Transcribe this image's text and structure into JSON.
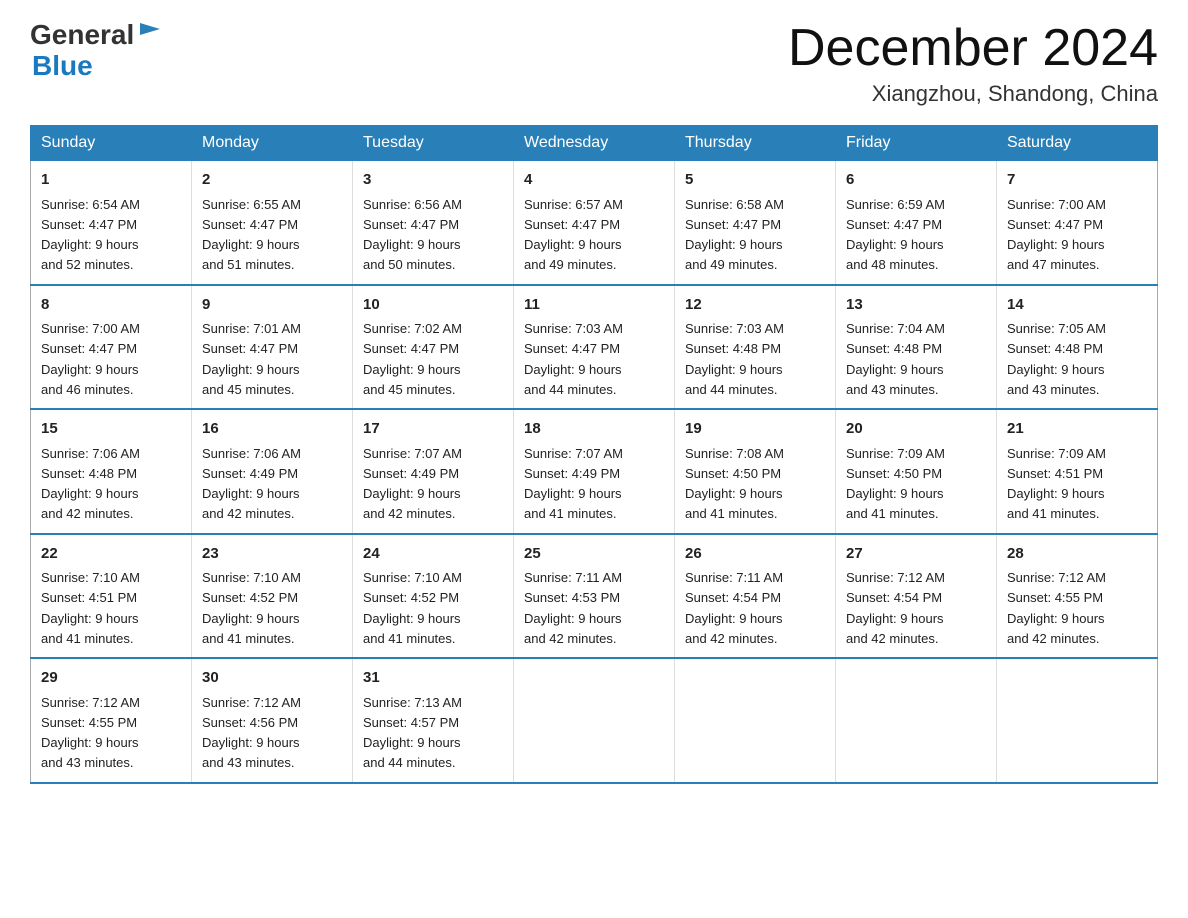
{
  "header": {
    "logo_general": "General",
    "logo_blue": "Blue",
    "month_year": "December 2024",
    "location": "Xiangzhou, Shandong, China"
  },
  "days_of_week": [
    "Sunday",
    "Monday",
    "Tuesday",
    "Wednesday",
    "Thursday",
    "Friday",
    "Saturday"
  ],
  "weeks": [
    [
      {
        "day": "1",
        "sunrise": "6:54 AM",
        "sunset": "4:47 PM",
        "daylight": "9 hours and 52 minutes."
      },
      {
        "day": "2",
        "sunrise": "6:55 AM",
        "sunset": "4:47 PM",
        "daylight": "9 hours and 51 minutes."
      },
      {
        "day": "3",
        "sunrise": "6:56 AM",
        "sunset": "4:47 PM",
        "daylight": "9 hours and 50 minutes."
      },
      {
        "day": "4",
        "sunrise": "6:57 AM",
        "sunset": "4:47 PM",
        "daylight": "9 hours and 49 minutes."
      },
      {
        "day": "5",
        "sunrise": "6:58 AM",
        "sunset": "4:47 PM",
        "daylight": "9 hours and 49 minutes."
      },
      {
        "day": "6",
        "sunrise": "6:59 AM",
        "sunset": "4:47 PM",
        "daylight": "9 hours and 48 minutes."
      },
      {
        "day": "7",
        "sunrise": "7:00 AM",
        "sunset": "4:47 PM",
        "daylight": "9 hours and 47 minutes."
      }
    ],
    [
      {
        "day": "8",
        "sunrise": "7:00 AM",
        "sunset": "4:47 PM",
        "daylight": "9 hours and 46 minutes."
      },
      {
        "day": "9",
        "sunrise": "7:01 AM",
        "sunset": "4:47 PM",
        "daylight": "9 hours and 45 minutes."
      },
      {
        "day": "10",
        "sunrise": "7:02 AM",
        "sunset": "4:47 PM",
        "daylight": "9 hours and 45 minutes."
      },
      {
        "day": "11",
        "sunrise": "7:03 AM",
        "sunset": "4:47 PM",
        "daylight": "9 hours and 44 minutes."
      },
      {
        "day": "12",
        "sunrise": "7:03 AM",
        "sunset": "4:48 PM",
        "daylight": "9 hours and 44 minutes."
      },
      {
        "day": "13",
        "sunrise": "7:04 AM",
        "sunset": "4:48 PM",
        "daylight": "9 hours and 43 minutes."
      },
      {
        "day": "14",
        "sunrise": "7:05 AM",
        "sunset": "4:48 PM",
        "daylight": "9 hours and 43 minutes."
      }
    ],
    [
      {
        "day": "15",
        "sunrise": "7:06 AM",
        "sunset": "4:48 PM",
        "daylight": "9 hours and 42 minutes."
      },
      {
        "day": "16",
        "sunrise": "7:06 AM",
        "sunset": "4:49 PM",
        "daylight": "9 hours and 42 minutes."
      },
      {
        "day": "17",
        "sunrise": "7:07 AM",
        "sunset": "4:49 PM",
        "daylight": "9 hours and 42 minutes."
      },
      {
        "day": "18",
        "sunrise": "7:07 AM",
        "sunset": "4:49 PM",
        "daylight": "9 hours and 41 minutes."
      },
      {
        "day": "19",
        "sunrise": "7:08 AM",
        "sunset": "4:50 PM",
        "daylight": "9 hours and 41 minutes."
      },
      {
        "day": "20",
        "sunrise": "7:09 AM",
        "sunset": "4:50 PM",
        "daylight": "9 hours and 41 minutes."
      },
      {
        "day": "21",
        "sunrise": "7:09 AM",
        "sunset": "4:51 PM",
        "daylight": "9 hours and 41 minutes."
      }
    ],
    [
      {
        "day": "22",
        "sunrise": "7:10 AM",
        "sunset": "4:51 PM",
        "daylight": "9 hours and 41 minutes."
      },
      {
        "day": "23",
        "sunrise": "7:10 AM",
        "sunset": "4:52 PM",
        "daylight": "9 hours and 41 minutes."
      },
      {
        "day": "24",
        "sunrise": "7:10 AM",
        "sunset": "4:52 PM",
        "daylight": "9 hours and 41 minutes."
      },
      {
        "day": "25",
        "sunrise": "7:11 AM",
        "sunset": "4:53 PM",
        "daylight": "9 hours and 42 minutes."
      },
      {
        "day": "26",
        "sunrise": "7:11 AM",
        "sunset": "4:54 PM",
        "daylight": "9 hours and 42 minutes."
      },
      {
        "day": "27",
        "sunrise": "7:12 AM",
        "sunset": "4:54 PM",
        "daylight": "9 hours and 42 minutes."
      },
      {
        "day": "28",
        "sunrise": "7:12 AM",
        "sunset": "4:55 PM",
        "daylight": "9 hours and 42 minutes."
      }
    ],
    [
      {
        "day": "29",
        "sunrise": "7:12 AM",
        "sunset": "4:55 PM",
        "daylight": "9 hours and 43 minutes."
      },
      {
        "day": "30",
        "sunrise": "7:12 AM",
        "sunset": "4:56 PM",
        "daylight": "9 hours and 43 minutes."
      },
      {
        "day": "31",
        "sunrise": "7:13 AM",
        "sunset": "4:57 PM",
        "daylight": "9 hours and 44 minutes."
      },
      null,
      null,
      null,
      null
    ]
  ],
  "labels": {
    "sunrise": "Sunrise:",
    "sunset": "Sunset:",
    "daylight": "Daylight:"
  }
}
